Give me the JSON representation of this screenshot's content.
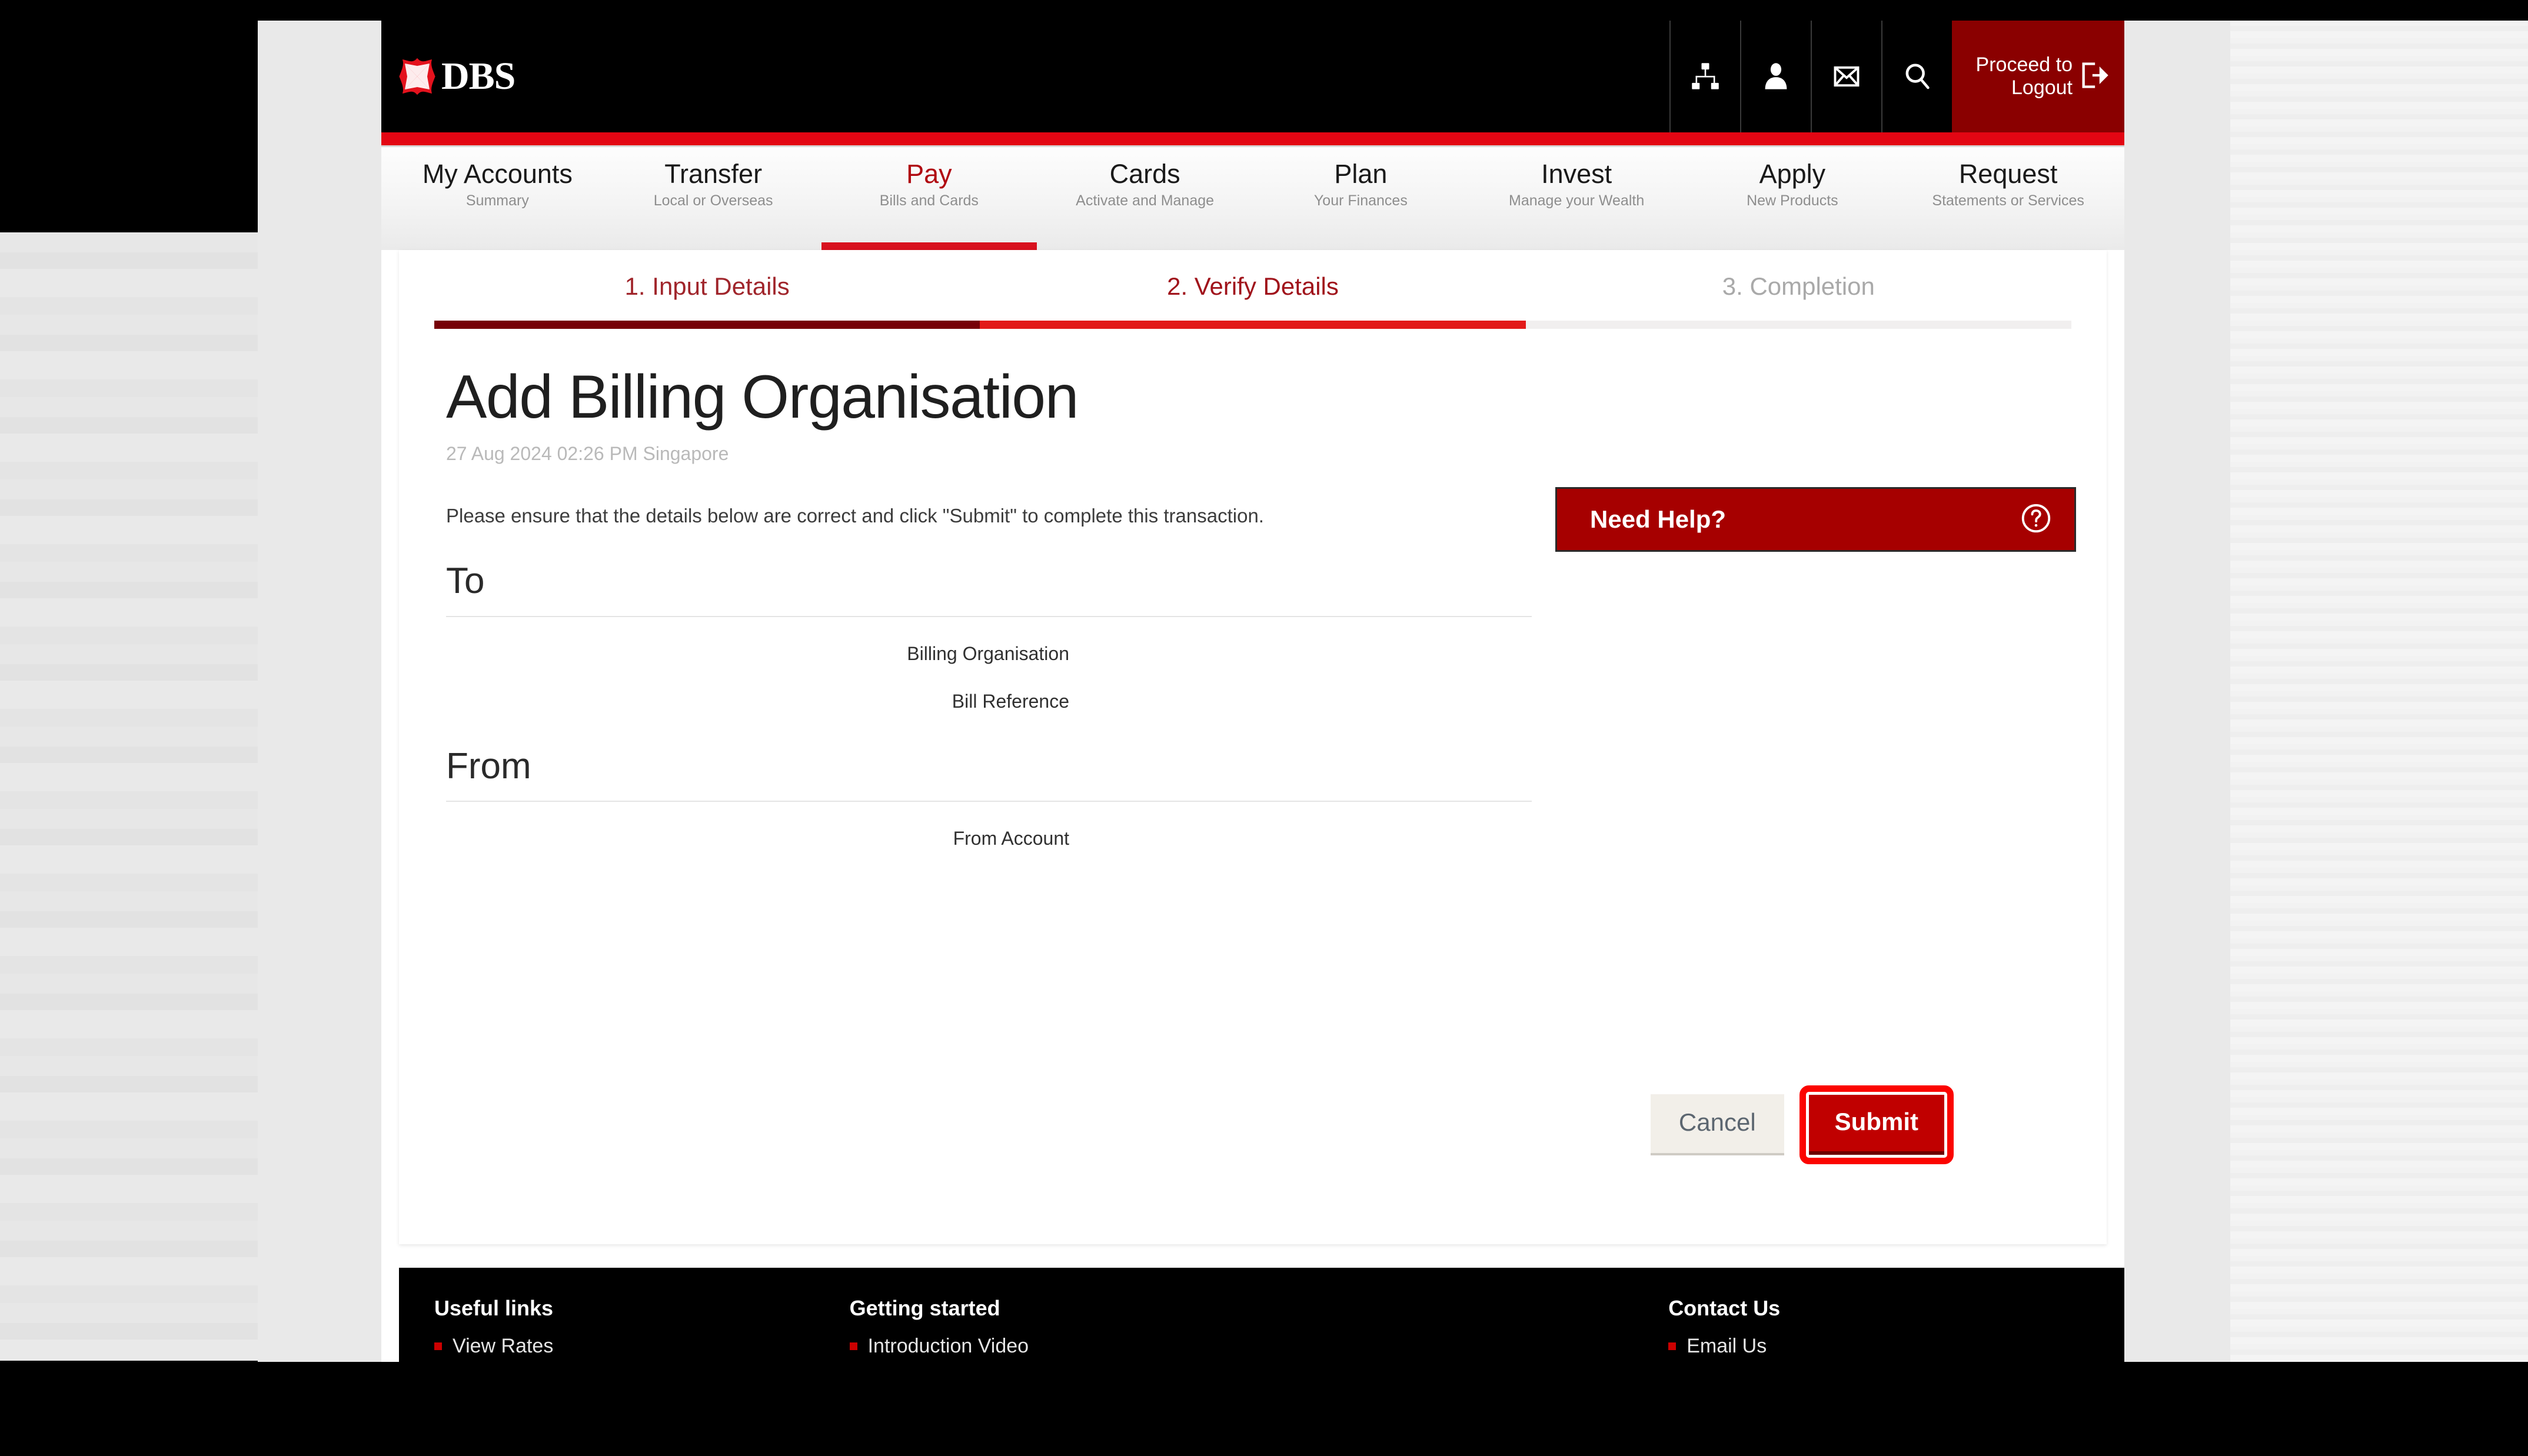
{
  "brand": {
    "logo_text": "DBS",
    "logo_mark": "dbs-diamond-logo"
  },
  "header": {
    "icons": [
      {
        "name": "sitemap-icon",
        "label": "Sitemap"
      },
      {
        "name": "user-icon",
        "label": "My Profile"
      },
      {
        "name": "envelope-icon",
        "label": "Messages"
      },
      {
        "name": "search-icon",
        "label": "Search"
      }
    ],
    "logout": {
      "label": "Proceed to\nLogout",
      "icon": "logout-exit-icon",
      "bg_color": "#8a0000"
    }
  },
  "nav": {
    "items": [
      {
        "title": "My Accounts",
        "sub": "Summary",
        "active": false
      },
      {
        "title": "Transfer",
        "sub": "Local or Overseas",
        "active": false
      },
      {
        "title": "Pay",
        "sub": "Bills and Cards",
        "active": true
      },
      {
        "title": "Cards",
        "sub": "Activate and Manage",
        "active": false
      },
      {
        "title": "Plan",
        "sub": "Your Finances",
        "active": false
      },
      {
        "title": "Invest",
        "sub": "Manage your Wealth",
        "active": false
      },
      {
        "title": "Apply",
        "sub": "New Products",
        "active": false
      },
      {
        "title": "Request",
        "sub": "Statements or Services",
        "active": false
      }
    ],
    "active_color": "#b00810"
  },
  "stepper": {
    "steps": [
      {
        "label": "1. Input Details",
        "state": "done"
      },
      {
        "label": "2. Verify Details",
        "state": "current"
      },
      {
        "label": "3. Completion",
        "state": "todo"
      }
    ],
    "done_color": "#760007",
    "current_color": "#e21a19",
    "todo_color": "#f1efef"
  },
  "main": {
    "title": "Add Billing Organisation",
    "timestamp": "27 Aug 2024 02:26 PM Singapore",
    "instruction": "Please ensure that the details below are correct and click \"Submit\" to complete this transaction.",
    "sections": [
      {
        "heading": "To",
        "fields": [
          {
            "label": "Billing Organisation",
            "value": ""
          },
          {
            "label": "Bill Reference",
            "value": ""
          }
        ]
      },
      {
        "heading": "From",
        "fields": [
          {
            "label": "From Account",
            "value": ""
          }
        ]
      }
    ],
    "buttons": {
      "cancel_label": "Cancel",
      "submit_label": "Submit",
      "submit_bg": "#c00000",
      "submit_highlight_color": "#fb0400"
    }
  },
  "help": {
    "label": "Need Help?",
    "icon": "question-circle-icon",
    "bg_color": "#a60000"
  },
  "footer": {
    "columns": [
      {
        "heading": "Useful links",
        "links": [
          {
            "label": "View Rates"
          }
        ]
      },
      {
        "heading": "Getting started",
        "links": [
          {
            "label": "Introduction Video"
          }
        ]
      },
      {
        "heading": "Contact Us",
        "links": [
          {
            "label": "Email Us"
          }
        ]
      }
    ],
    "bullet_color": "#cc0000"
  }
}
